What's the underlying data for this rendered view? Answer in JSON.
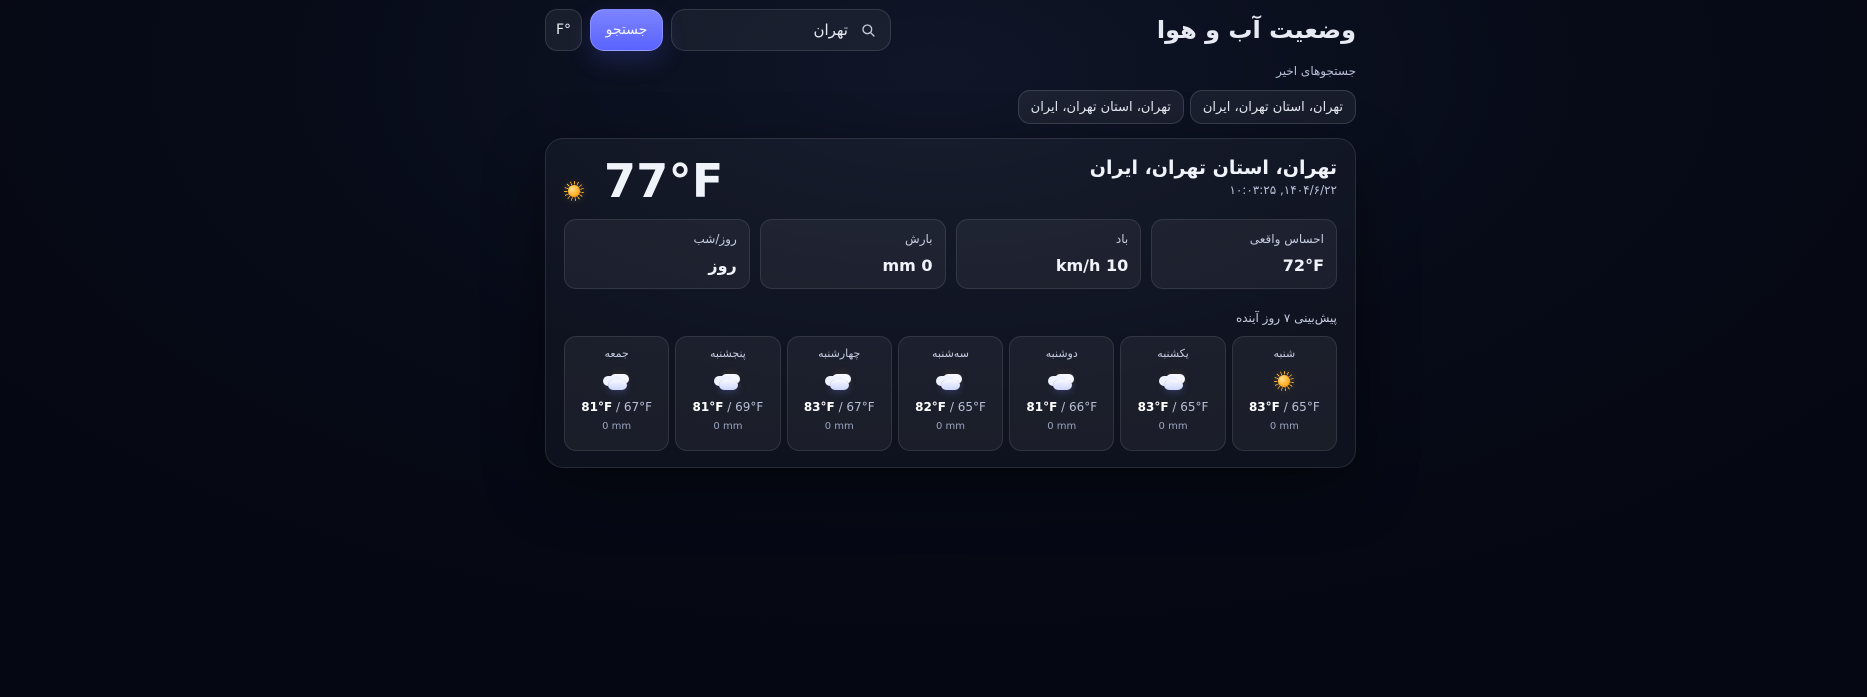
{
  "app": {
    "title": "وضعیت آب و هوا",
    "accent": "#5a63ff"
  },
  "search": {
    "value": "تهران",
    "button_label": "جستجو",
    "unit_toggle_label": "F°",
    "icon": "search-icon"
  },
  "recent": {
    "label": "جستجوهای اخیر",
    "items": [
      {
        "label": "تهران، استان تهران، ایران"
      },
      {
        "label": "تهران، استان تهران، ایران"
      }
    ]
  },
  "current": {
    "location": "تهران، استان تهران، ایران",
    "datetime": "۱۴۰۴/۶/۲۲, ۱۰:۰۳:۲۵",
    "temperature": "77°F",
    "icon": "sun-icon",
    "stats": [
      {
        "label": "احساس واقعی",
        "value": "72°F"
      },
      {
        "label": "باد",
        "value": "10 km/h"
      },
      {
        "label": "بارش",
        "value": "0 mm"
      },
      {
        "label": "روز/شب",
        "value": "روز"
      }
    ]
  },
  "forecast": {
    "title": "پیش‌بینی ۷ روز آینده",
    "days": [
      {
        "day": "شنبه",
        "icon": "sun-icon",
        "high": "83°F",
        "low": "65°F",
        "precip": "0 mm"
      },
      {
        "day": "یکشنبه",
        "icon": "partly-cloudy-icon",
        "high": "83°F",
        "low": "65°F",
        "precip": "0 mm"
      },
      {
        "day": "دوشنبه",
        "icon": "partly-cloudy-icon",
        "high": "81°F",
        "low": "66°F",
        "precip": "0 mm"
      },
      {
        "day": "سه‌شنبه",
        "icon": "partly-cloudy-icon",
        "high": "82°F",
        "low": "65°F",
        "precip": "0 mm"
      },
      {
        "day": "چهارشنبه",
        "icon": "partly-cloudy-icon",
        "high": "83°F",
        "low": "67°F",
        "precip": "0 mm"
      },
      {
        "day": "پنجشنبه",
        "icon": "partly-cloudy-icon",
        "high": "81°F",
        "low": "69°F",
        "precip": "0 mm"
      },
      {
        "day": "جمعه",
        "icon": "partly-cloudy-icon",
        "high": "81°F",
        "low": "67°F",
        "precip": "0 mm"
      }
    ]
  }
}
